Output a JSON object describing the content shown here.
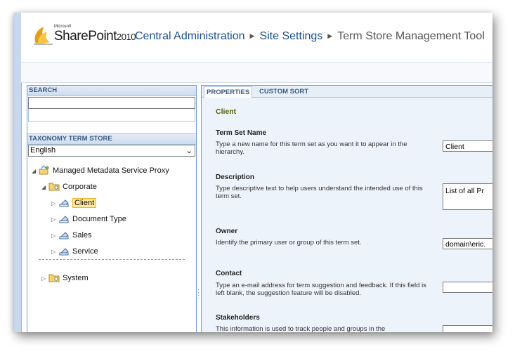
{
  "header": {
    "brand_small": "Microsoft",
    "brand": "SharePoint",
    "version": "2010",
    "breadcrumb": [
      "Central Administration",
      "Site Settings",
      "Term Store Management Tool"
    ]
  },
  "left": {
    "search_header": "SEARCH",
    "search_value": "",
    "taxonomy_header": "TAXONOMY TERM STORE",
    "language": "English",
    "tree": {
      "root": "Managed Metadata Service Proxy",
      "group": "Corporate",
      "term_sets": [
        "Client",
        "Document Type",
        "Sales",
        "Service"
      ],
      "system": "System"
    }
  },
  "right": {
    "tabs": [
      "PROPERTIES",
      "CUSTOM SORT"
    ],
    "term_set_title": "Client",
    "fields": {
      "name_label": "Term Set Name",
      "name_desc": "Type a new name for this term set as you want it to appear in the hierarchy.",
      "name_value": "Client",
      "desc_label": "Description",
      "desc_desc": "Type descriptive text to help users understand the intended use of this term set.",
      "desc_value": "List of all Pr",
      "owner_label": "Owner",
      "owner_desc": "Identify the primary user or group of this term set.",
      "owner_value": "domain\\eric.",
      "contact_label": "Contact",
      "contact_desc": "Type an e-mail address for term suggestion and feedback. If this field is left blank, the suggestion feature will be disabled.",
      "contact_value": "",
      "stake_label": "Stakeholders",
      "stake_desc": "This information is used to track people and groups in the",
      "stake_value": ""
    }
  }
}
